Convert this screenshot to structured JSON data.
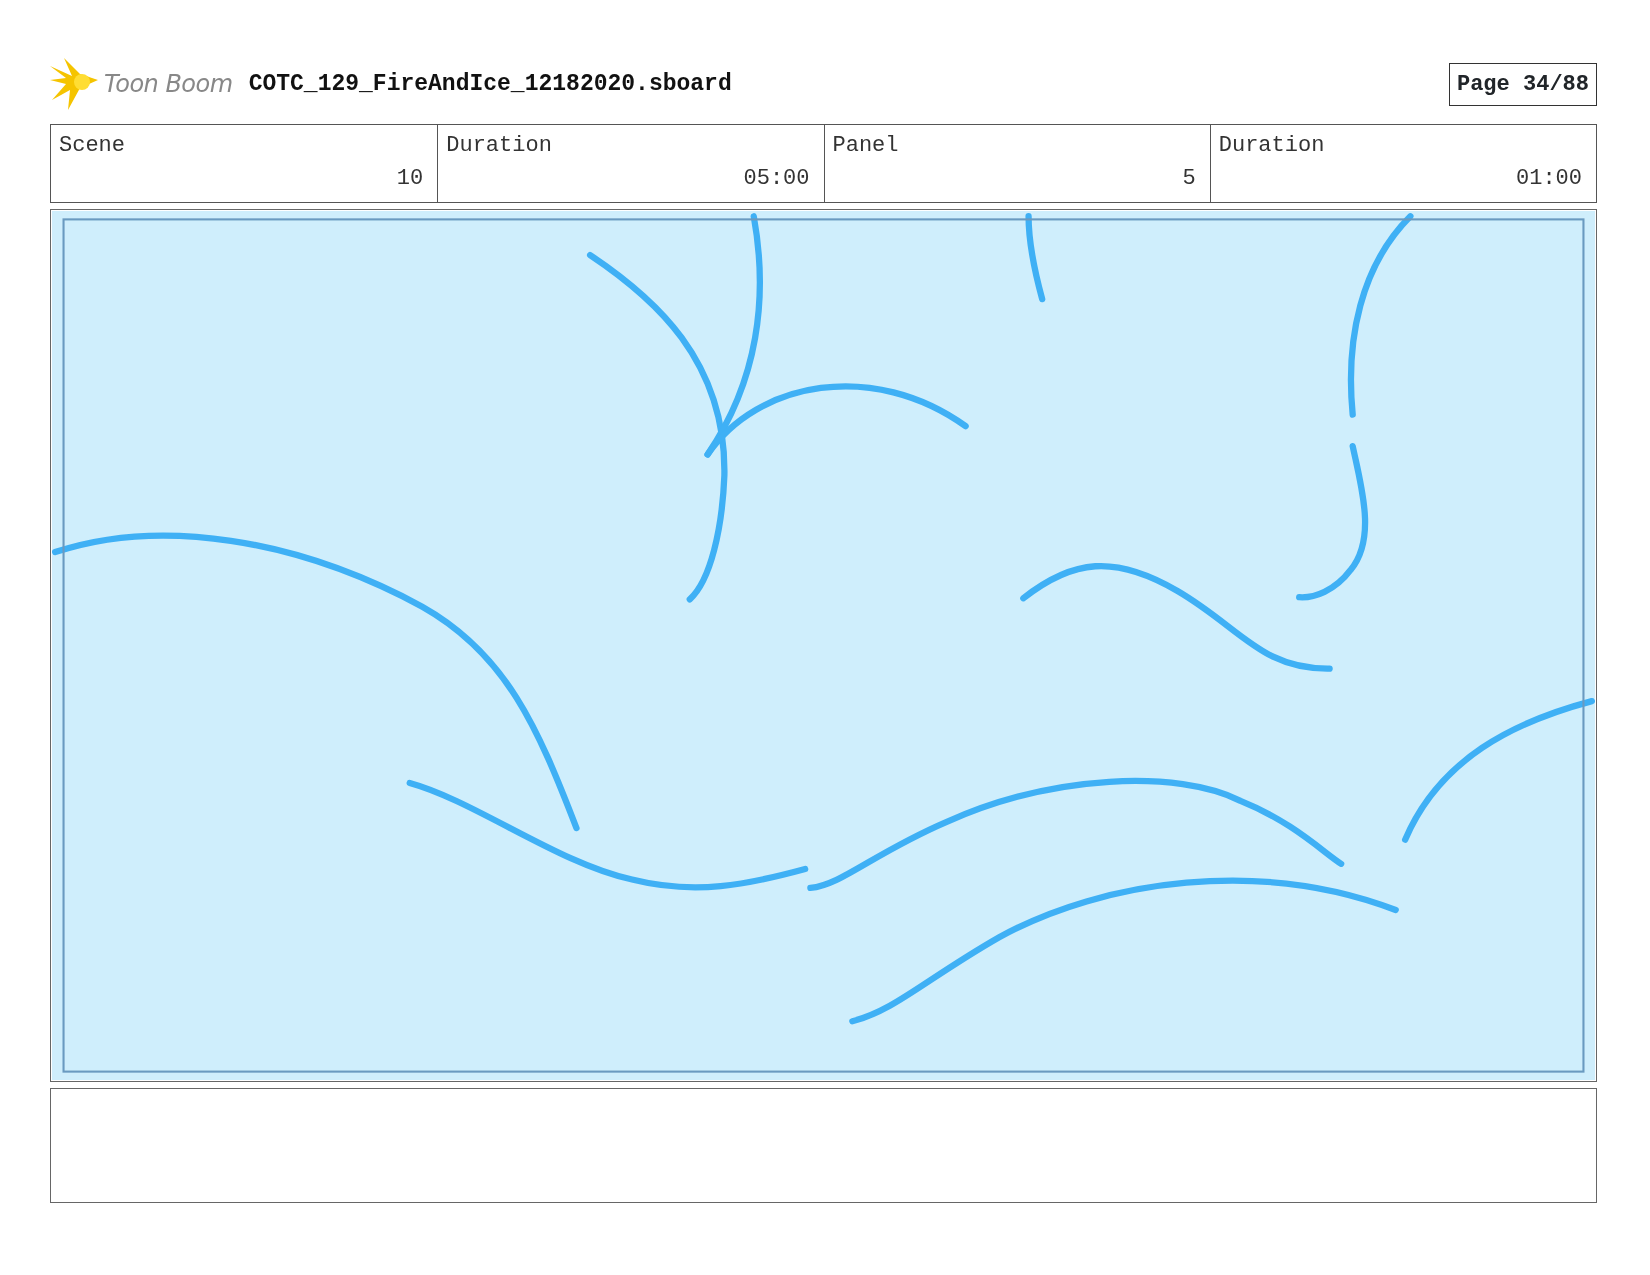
{
  "header": {
    "logo_text": "Toon Boom",
    "filename": "COTC_129_FireAndIce_12182020.sboard",
    "page": "Page 34/88"
  },
  "info_fields": [
    {
      "label": "Scene",
      "value": "10"
    },
    {
      "label": "Duration",
      "value": "05:00"
    },
    {
      "label": "Panel",
      "value": "5"
    },
    {
      "label": "Duration",
      "value": "01:00"
    }
  ]
}
